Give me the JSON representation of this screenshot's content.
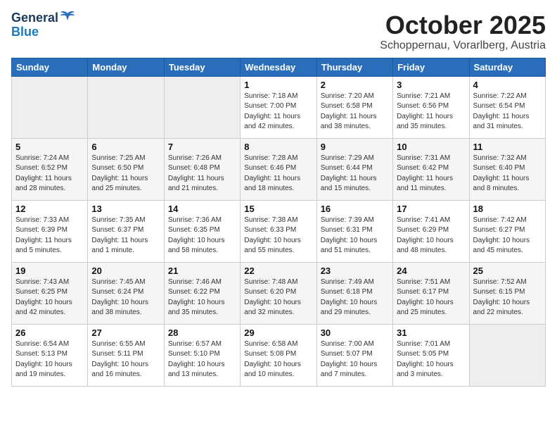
{
  "header": {
    "logo_line1": "General",
    "logo_line2": "Blue",
    "month": "October 2025",
    "location": "Schoppernau, Vorarlberg, Austria"
  },
  "days_of_week": [
    "Sunday",
    "Monday",
    "Tuesday",
    "Wednesday",
    "Thursday",
    "Friday",
    "Saturday"
  ],
  "weeks": [
    [
      {
        "day": "",
        "info": ""
      },
      {
        "day": "",
        "info": ""
      },
      {
        "day": "",
        "info": ""
      },
      {
        "day": "1",
        "info": "Sunrise: 7:18 AM\nSunset: 7:00 PM\nDaylight: 11 hours and 42 minutes."
      },
      {
        "day": "2",
        "info": "Sunrise: 7:20 AM\nSunset: 6:58 PM\nDaylight: 11 hours and 38 minutes."
      },
      {
        "day": "3",
        "info": "Sunrise: 7:21 AM\nSunset: 6:56 PM\nDaylight: 11 hours and 35 minutes."
      },
      {
        "day": "4",
        "info": "Sunrise: 7:22 AM\nSunset: 6:54 PM\nDaylight: 11 hours and 31 minutes."
      }
    ],
    [
      {
        "day": "5",
        "info": "Sunrise: 7:24 AM\nSunset: 6:52 PM\nDaylight: 11 hours and 28 minutes."
      },
      {
        "day": "6",
        "info": "Sunrise: 7:25 AM\nSunset: 6:50 PM\nDaylight: 11 hours and 25 minutes."
      },
      {
        "day": "7",
        "info": "Sunrise: 7:26 AM\nSunset: 6:48 PM\nDaylight: 11 hours and 21 minutes."
      },
      {
        "day": "8",
        "info": "Sunrise: 7:28 AM\nSunset: 6:46 PM\nDaylight: 11 hours and 18 minutes."
      },
      {
        "day": "9",
        "info": "Sunrise: 7:29 AM\nSunset: 6:44 PM\nDaylight: 11 hours and 15 minutes."
      },
      {
        "day": "10",
        "info": "Sunrise: 7:31 AM\nSunset: 6:42 PM\nDaylight: 11 hours and 11 minutes."
      },
      {
        "day": "11",
        "info": "Sunrise: 7:32 AM\nSunset: 6:40 PM\nDaylight: 11 hours and 8 minutes."
      }
    ],
    [
      {
        "day": "12",
        "info": "Sunrise: 7:33 AM\nSunset: 6:39 PM\nDaylight: 11 hours and 5 minutes."
      },
      {
        "day": "13",
        "info": "Sunrise: 7:35 AM\nSunset: 6:37 PM\nDaylight: 11 hours and 1 minute."
      },
      {
        "day": "14",
        "info": "Sunrise: 7:36 AM\nSunset: 6:35 PM\nDaylight: 10 hours and 58 minutes."
      },
      {
        "day": "15",
        "info": "Sunrise: 7:38 AM\nSunset: 6:33 PM\nDaylight: 10 hours and 55 minutes."
      },
      {
        "day": "16",
        "info": "Sunrise: 7:39 AM\nSunset: 6:31 PM\nDaylight: 10 hours and 51 minutes."
      },
      {
        "day": "17",
        "info": "Sunrise: 7:41 AM\nSunset: 6:29 PM\nDaylight: 10 hours and 48 minutes."
      },
      {
        "day": "18",
        "info": "Sunrise: 7:42 AM\nSunset: 6:27 PM\nDaylight: 10 hours and 45 minutes."
      }
    ],
    [
      {
        "day": "19",
        "info": "Sunrise: 7:43 AM\nSunset: 6:25 PM\nDaylight: 10 hours and 42 minutes."
      },
      {
        "day": "20",
        "info": "Sunrise: 7:45 AM\nSunset: 6:24 PM\nDaylight: 10 hours and 38 minutes."
      },
      {
        "day": "21",
        "info": "Sunrise: 7:46 AM\nSunset: 6:22 PM\nDaylight: 10 hours and 35 minutes."
      },
      {
        "day": "22",
        "info": "Sunrise: 7:48 AM\nSunset: 6:20 PM\nDaylight: 10 hours and 32 minutes."
      },
      {
        "day": "23",
        "info": "Sunrise: 7:49 AM\nSunset: 6:18 PM\nDaylight: 10 hours and 29 minutes."
      },
      {
        "day": "24",
        "info": "Sunrise: 7:51 AM\nSunset: 6:17 PM\nDaylight: 10 hours and 25 minutes."
      },
      {
        "day": "25",
        "info": "Sunrise: 7:52 AM\nSunset: 6:15 PM\nDaylight: 10 hours and 22 minutes."
      }
    ],
    [
      {
        "day": "26",
        "info": "Sunrise: 6:54 AM\nSunset: 5:13 PM\nDaylight: 10 hours and 19 minutes."
      },
      {
        "day": "27",
        "info": "Sunrise: 6:55 AM\nSunset: 5:11 PM\nDaylight: 10 hours and 16 minutes."
      },
      {
        "day": "28",
        "info": "Sunrise: 6:57 AM\nSunset: 5:10 PM\nDaylight: 10 hours and 13 minutes."
      },
      {
        "day": "29",
        "info": "Sunrise: 6:58 AM\nSunset: 5:08 PM\nDaylight: 10 hours and 10 minutes."
      },
      {
        "day": "30",
        "info": "Sunrise: 7:00 AM\nSunset: 5:07 PM\nDaylight: 10 hours and 7 minutes."
      },
      {
        "day": "31",
        "info": "Sunrise: 7:01 AM\nSunset: 5:05 PM\nDaylight: 10 hours and 3 minutes."
      },
      {
        "day": "",
        "info": ""
      }
    ]
  ]
}
